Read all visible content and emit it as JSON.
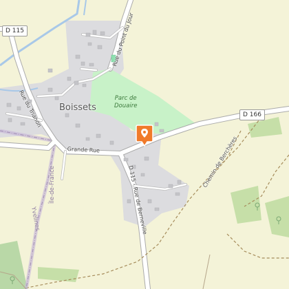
{
  "map": {
    "town": "Boissets",
    "park": [
      "Parc de",
      "Douaire"
    ],
    "roads": {
      "d115_shield": "D 115",
      "d166_shield": "D 166",
      "d115_label": "D 115 - Rue de Berneville",
      "rue_trianon": "Rue du Trianon",
      "grande_rue": "Grande Rue",
      "rue_point_du_jour": "Rue du Point du Jour",
      "chemin_bercheres": "Chemin de Berchères"
    },
    "regions": {
      "ile_de_france": "Île-de-France",
      "yvelines": "Yvelines"
    },
    "marker": {
      "icon": "map-pin-icon",
      "color": "#f07a2a"
    }
  }
}
